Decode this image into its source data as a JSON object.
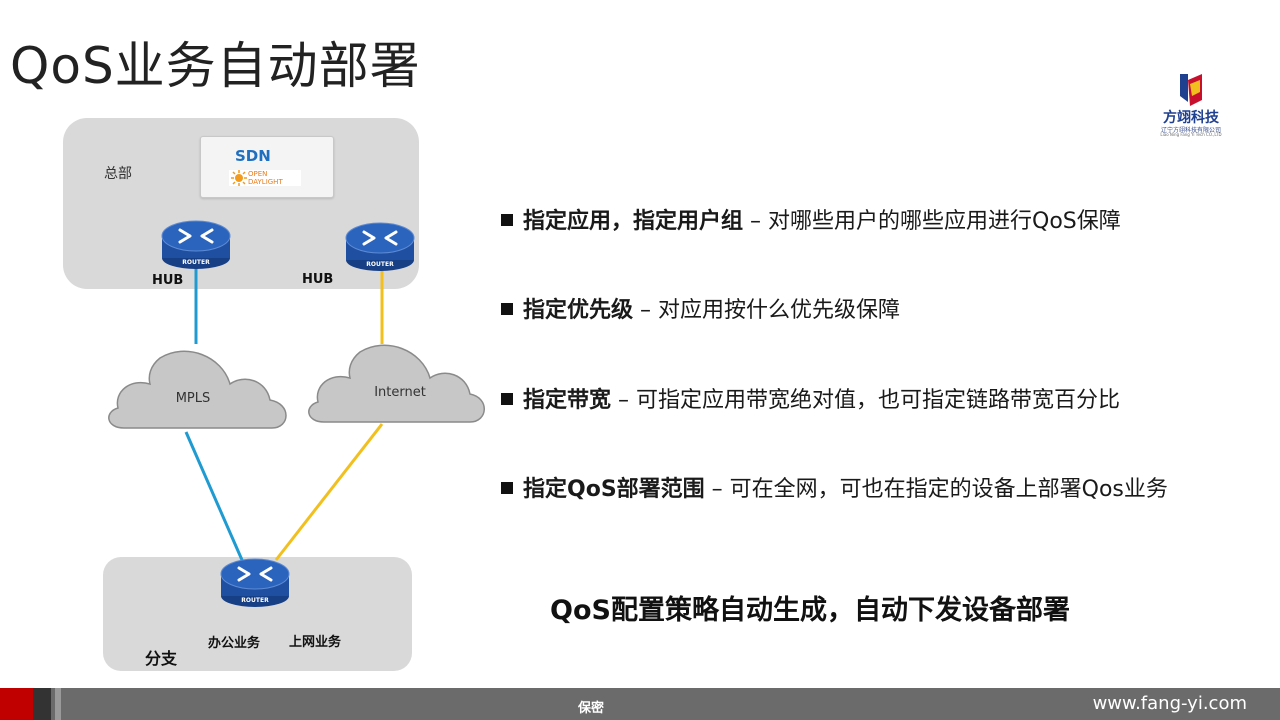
{
  "slide": {
    "title": "QoS业务自动部署"
  },
  "logo": {
    "name": "方翊科技",
    "subtitle": "辽宁方翊科技有限公司",
    "subtitle_en": "Liao Ning Fang Yi Tech CO.,LTD"
  },
  "diagram": {
    "hq_label": "总部",
    "sdn_label": "SDN",
    "controller_logo_text": [
      "OPEN",
      "DAYLIGHT"
    ],
    "router_label": "ROUTER",
    "hub_left": "HUB",
    "hub_right": "HUB",
    "cloud_mpls": "MPLS",
    "cloud_internet": "Internet",
    "branch_label": "分支",
    "service_office": "办公业务",
    "service_internet": "上网业务",
    "colors": {
      "mpls_link": "#1f9bd1",
      "internet_link": "#f2c01e",
      "router_fill": "#1f4fa0",
      "cloud_fill": "#c7c7c7"
    }
  },
  "bullets": [
    {
      "bold": "指定应用，指定用户组",
      "text": " – 对哪些用户的哪些应用进行QoS保障"
    },
    {
      "bold": "指定优先级",
      "text": " – 对应用按什么优先级保障"
    },
    {
      "bold": "指定带宽",
      "text": " – 可指定应用带宽绝对值，也可指定链路带宽百分比"
    },
    {
      "bold": "指定QoS部署范围",
      "text": " – 可在全网，可也在指定的设备上部署Qos业务"
    }
  ],
  "conclusion": "QoS配置策略自动生成，自动下发设备部署",
  "footer": {
    "confidential": "保密",
    "url": "www.fang-yi.com"
  }
}
